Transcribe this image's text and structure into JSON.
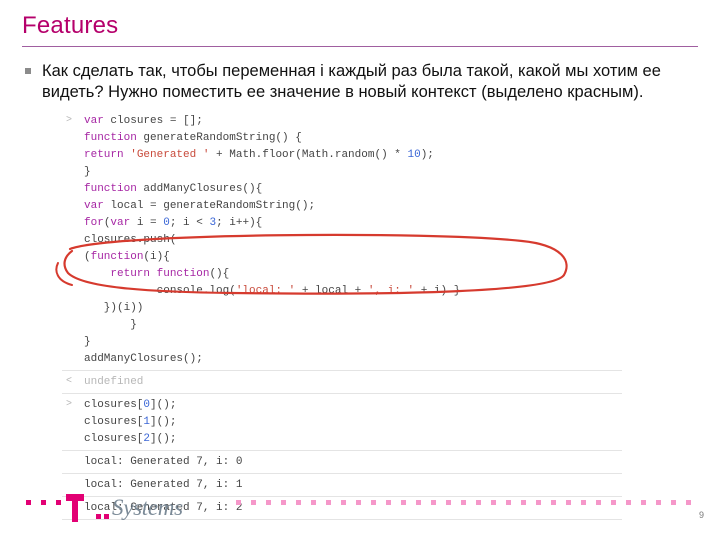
{
  "title": "Features",
  "bullet": "Как сделать так, чтобы переменная i каждый раз была такой, какой мы хотим ее видеть? Нужно поместить ее значение в новый контекст (выделено красным).",
  "page_number": "9",
  "logo_text": "Systems",
  "code": {
    "l1a": "var",
    "l1b": " closures = [];",
    "l2a": "function",
    "l2b": " generateRandomString() {",
    "l3a": "return ",
    "l3s": "'Generated '",
    "l3b": " + Math.floor(Math.random() * ",
    "l3n": "10",
    "l3c": ");",
    "l4": "}",
    "l5a": "function",
    "l5b": " addManyClosures(){",
    "l6a": "var",
    "l6b": " local = generateRandomString();",
    "l7a": "for",
    "l7b": "(",
    "l7c": "var",
    "l7d": " i = ",
    "l7n1": "0",
    "l7e": "; i < ",
    "l7n2": "3",
    "l7f": "; i++){",
    "l8": "closures.push(",
    "l9a": "(",
    "l9b": "function",
    "l9c": "(i){",
    "l10a": "    ",
    "l10b": "return function",
    "l10c": "(){",
    "l11a": "           console.log(",
    "l11s1": "'local: '",
    "l11b": " + local + ",
    "l11s2": "', i: '",
    "l11c": " + i) }",
    "l12": "   })(i))",
    "l13": "       }",
    "l14": "}",
    "l15": "addManyClosures();",
    "und": "undefined",
    "c0a": "closures[",
    "c0n": "0",
    "c0b": "]();",
    "c1a": "closures[",
    "c1n": "1",
    "c1b": "]();",
    "c2a": "closures[",
    "c2n": "2",
    "c2b": "]();",
    "o0": "local: Generated 7, i: 0",
    "o1": "local: Generated 7, i: 1",
    "o2": "local: Generated 7, i: 2"
  }
}
